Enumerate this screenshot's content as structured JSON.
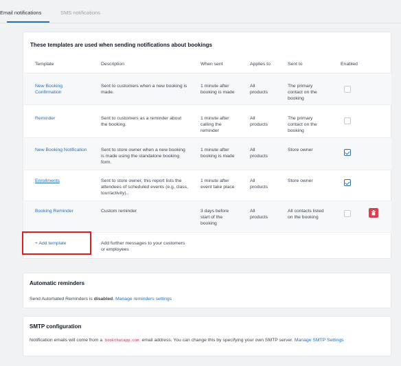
{
  "tabs": [
    {
      "label": "Email notifications",
      "active": true
    },
    {
      "label": "SMS notifications",
      "active": false
    }
  ],
  "templates": {
    "title": "These templates are used when sending notifications about bookings",
    "headers": {
      "template": "Template",
      "description": "Description",
      "when_sent": "When sent",
      "applies_to": "Applies to",
      "sent_to": "Sent to",
      "enabled": "Enabled"
    },
    "rows": [
      {
        "name": [
          "New Booking",
          "Confirmation"
        ],
        "description": [
          "Sent to customers when a new booking is",
          "made."
        ],
        "when_sent": [
          "1 minute after",
          "booking is made"
        ],
        "applies_to": [
          "All",
          "products"
        ],
        "sent_to": [
          "The primary",
          "contact on the",
          "booking"
        ],
        "enabled": false
      },
      {
        "name": [
          "Reminder"
        ],
        "description": [
          "Sent to customers as a reminder about",
          "the booking."
        ],
        "when_sent": [
          "1 minute after",
          "calling the",
          "reminder"
        ],
        "applies_to": [
          "All",
          "products"
        ],
        "sent_to": [
          "The primary",
          "contact on the",
          "booking"
        ],
        "enabled": false
      },
      {
        "name": [
          "New Booking Notification"
        ],
        "description": [
          "Sent to store owner when a new booking",
          "is made using the standalone booking",
          "form."
        ],
        "when_sent": [
          "1 minute after",
          "booking is made"
        ],
        "applies_to": [
          "All",
          "products"
        ],
        "sent_to": [
          "Store owner"
        ],
        "enabled": true
      },
      {
        "name": [
          "Enrollments"
        ],
        "description": [
          "Sent to store owner, this report lists the",
          "attendees of scheduled events (e.g. class,",
          "tour/activity).."
        ],
        "when_sent": [
          "1 minute after",
          "event take place"
        ],
        "applies_to": [
          "All",
          "products"
        ],
        "sent_to": [
          "Store owner"
        ],
        "enabled": true
      },
      {
        "name": [
          "Booking Reminder"
        ],
        "description": [
          "Custom reminder"
        ],
        "when_sent": [
          "3 days before",
          "start of the",
          "booking"
        ],
        "applies_to": [
          "All",
          "products"
        ],
        "sent_to": [
          "All contacts listed",
          "on the booking"
        ],
        "enabled": false,
        "deletable": true
      }
    ],
    "add_template": {
      "label": "+ Add template",
      "description": [
        "Add further messages to your customers",
        "or employees"
      ]
    }
  },
  "automatic_reminders": {
    "title": "Automatic reminders",
    "text_prefix": "Send Automated Reminders is ",
    "status": "disabled",
    "text_suffix": ".",
    "link": "Manage reminders settings"
  },
  "smtp": {
    "title": "SMTP configuration",
    "text_prefix": "Notification emails will come from a",
    "email_domain": "bookthatapp.com",
    "text_middle": "email address. You can change this by specifying your own SMTP server.",
    "link": "Manage SMTP Settings"
  },
  "colors": {
    "link": "#2b6cb0",
    "delete": "#d9404e",
    "highlight": "#e01a1a"
  }
}
